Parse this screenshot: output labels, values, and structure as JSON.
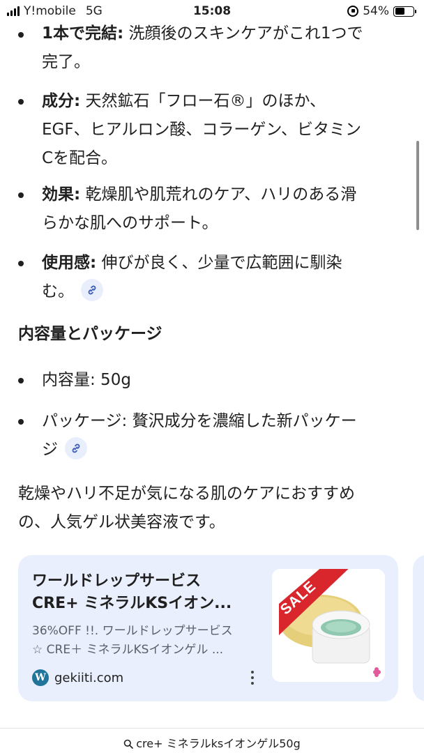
{
  "status_bar": {
    "carrier": "Y!mobile",
    "network": "5G",
    "time": "15:08",
    "battery": "54%",
    "battery_level": 0.54
  },
  "bullets_top": [
    {
      "label": "1本で完結:",
      "text_line1": " 洗顔後のスキンケアがこれ1つで",
      "text_line2": "完了。"
    },
    {
      "label": "成分:",
      "text_line1": " 天然鉱石「フロー石®」のほか、",
      "text_line2": "EGF、ヒアルロン酸、コラーゲン、ビタミン",
      "text_line3": "Cを配合。"
    },
    {
      "label": "効果:",
      "text_line1": " 乾燥肌や肌荒れのケア、ハリのある滑",
      "text_line2": "らかな肌へのサポート。"
    },
    {
      "label": "使用感:",
      "text_line1": " 伸びが良く、少量で広範囲に馴染",
      "text_line2": "む。"
    }
  ],
  "section_heading": "内容量とパッケージ",
  "bullets_bottom": [
    {
      "text_line1": "内容量: 50g"
    },
    {
      "text_line1": "パッケージ: 贅沢成分を濃縮した新パッケー",
      "text_line2": "ジ"
    }
  ],
  "summary": {
    "line1": "乾燥やハリ不足が気になる肌のケアにおすすめ",
    "line2": "の、人気ゲル状美容液です。"
  },
  "card": {
    "title_line1": "ワールドレップサービス",
    "title_line2": "CRE+ ミネラルKSイオン...",
    "desc_line1": "36%OFF !!. ワールドレップサービス",
    "desc_line2": "☆ CRE＋ ミネラルKSイオンゲル ...",
    "source": "gekiiti.com",
    "sale_badge": "SALE",
    "accent": "#e9effc"
  },
  "bottom_bar": {
    "query": "cre+ ミネラルksイオンゲル50g"
  },
  "icons": {
    "link": "link-icon",
    "search": "search-icon",
    "site": "wordpress-icon",
    "more": "more-vert-icon"
  }
}
